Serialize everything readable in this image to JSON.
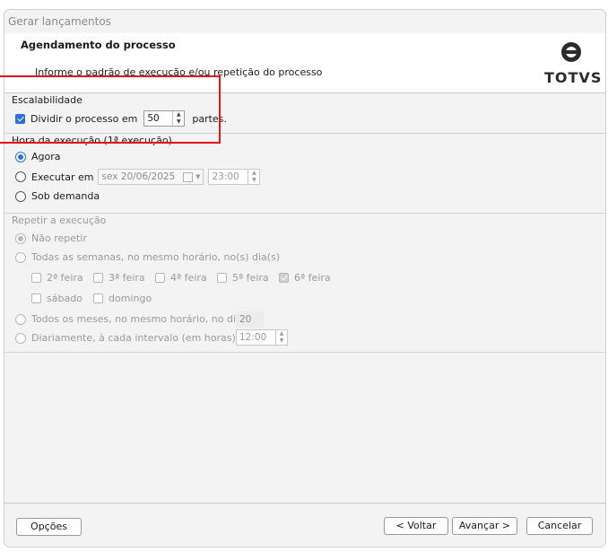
{
  "window": {
    "title": "Gerar lançamentos"
  },
  "header": {
    "title": "Agendamento do processo",
    "subtitle": "Informe o padrão de execução e/ou repetição do processo",
    "logo_text": "TOTVS"
  },
  "scalability": {
    "legend": "Escalabilidade",
    "divide_label": "Dividir o processo em",
    "divide_value": "50",
    "parts_label": "partes.",
    "checked": true
  },
  "execution_time": {
    "legend": "Hora da execução (1ª execução)",
    "now_label": "Agora",
    "run_at_label": "Executar em",
    "date_value": "sex  20/06/2025",
    "time_value": "23:00",
    "on_demand_label": "Sob demanda",
    "selected": "Agora"
  },
  "repeat": {
    "legend": "Repetir a execução",
    "no_repeat_label": "Não repetir",
    "weekly_label": "Todas as semanas, no mesmo horário, no(s) dia(s)",
    "days": [
      {
        "label": "2ª feira",
        "checked": false
      },
      {
        "label": "3ª feira",
        "checked": false
      },
      {
        "label": "4ª feira",
        "checked": false
      },
      {
        "label": "5ª feira",
        "checked": false
      },
      {
        "label": "6ª feira",
        "checked": true
      },
      {
        "label": "sábado",
        "checked": false
      },
      {
        "label": "domingo",
        "checked": false
      }
    ],
    "monthly_label": "Todos os meses, no mesmo horário, no dia",
    "monthly_value": "20",
    "daily_label": "Diariamente, à cada intervalo (em horas) de",
    "daily_value": "12:00",
    "selected": "Não repetir"
  },
  "footer": {
    "options_label": "Opções",
    "back_label": "< Voltar",
    "next_label": "Avançar >",
    "cancel_label": "Cancelar"
  },
  "colors": {
    "accent": "#2a6fd6",
    "annotation": "#e01616"
  }
}
